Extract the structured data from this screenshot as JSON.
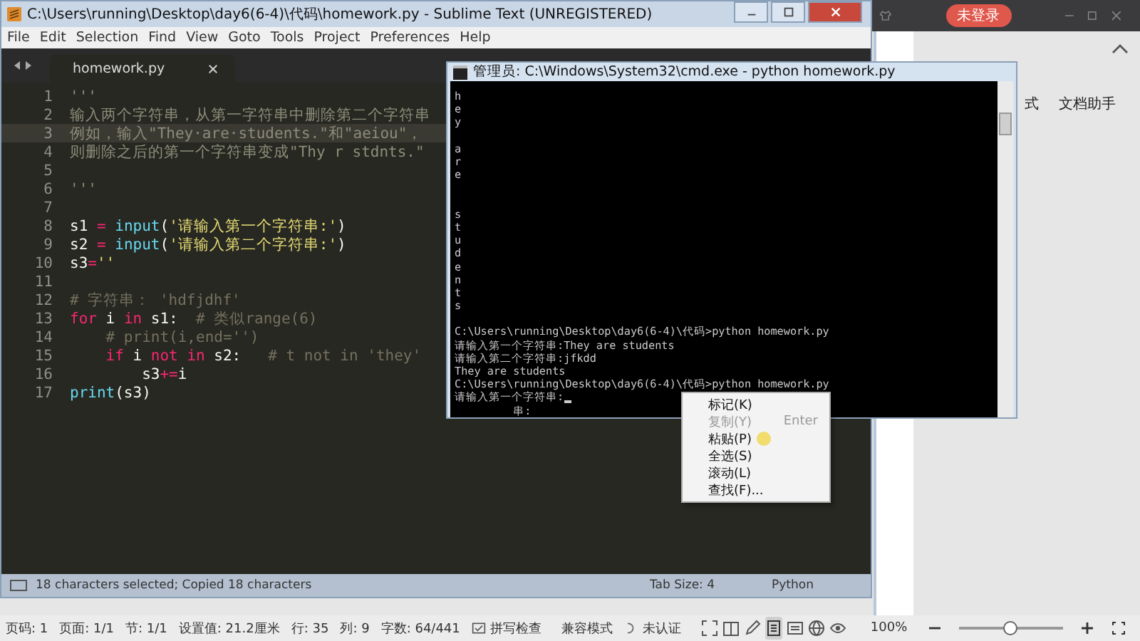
{
  "background_app": {
    "account_badge": "未登录",
    "ribbon": {
      "style_label": "式",
      "assistant_label": "文档助手"
    },
    "status_bar": {
      "items": [
        {
          "kind": "text",
          "text": "页码: 1"
        },
        {
          "kind": "text",
          "text": "页面: 1/1"
        },
        {
          "kind": "text",
          "text": "节: 1/1"
        },
        {
          "kind": "text",
          "text": "设置值: 21.2厘米"
        },
        {
          "kind": "text",
          "text": "行: 35"
        },
        {
          "kind": "text",
          "text": "列: 9"
        },
        {
          "kind": "text",
          "text": "字数: 64/441"
        },
        {
          "kind": "spell",
          "text": "拼写检查"
        },
        {
          "kind": "text",
          "text": "兼容模式"
        },
        {
          "kind": "cert",
          "text": "未认证"
        }
      ],
      "zoom": {
        "value": "100%",
        "level": 0.5
      }
    }
  },
  "editor": {
    "title": "C:\\Users\\running\\Desktop\\day6(6-4)\\代码\\homework.py - Sublime Text (UNREGISTERED)",
    "menu": [
      "File",
      "Edit",
      "Selection",
      "Find",
      "View",
      "Goto",
      "Tools",
      "Project",
      "Preferences",
      "Help"
    ],
    "tab": {
      "label": "homework.py",
      "selected": true
    },
    "lines": [
      {
        "number": "1",
        "current": false,
        "tokens": [
          {
            "kind": "docstring",
            "text": "'''"
          }
        ]
      },
      {
        "number": "2",
        "current": false,
        "tokens": [
          {
            "kind": "docstring",
            "text": "输入两个字符串，从第一字符串中删除第二个字符串"
          }
        ]
      },
      {
        "number": "3",
        "current": true,
        "tokens": [
          {
            "kind": "docstring",
            "text": "例如，输入\"They·are·students.\"和\"aeiou\"，"
          }
        ]
      },
      {
        "number": "4",
        "current": false,
        "tokens": [
          {
            "kind": "docstring",
            "text": "则删除之后的第一个字符串变成\"Thy r stdnts.\""
          }
        ]
      },
      {
        "number": "5",
        "current": false
      },
      {
        "number": "6",
        "current": false,
        "tokens": [
          {
            "kind": "docstring",
            "text": "'''"
          }
        ]
      },
      {
        "number": "7",
        "current": false
      },
      {
        "number": "8",
        "current": false,
        "tokens": [
          {
            "kind": "plain",
            "text": "s1 "
          },
          {
            "kind": "keyword",
            "text": "="
          },
          {
            "kind": "builtin",
            "text": " input"
          },
          {
            "kind": "plain",
            "text": "("
          },
          {
            "kind": "string",
            "text": "'请输入第一个字符串:'"
          },
          {
            "kind": "plain",
            "text": ")"
          }
        ]
      },
      {
        "number": "9",
        "current": false,
        "tokens": [
          {
            "kind": "plain",
            "text": "s2 "
          },
          {
            "kind": "keyword",
            "text": "="
          },
          {
            "kind": "builtin",
            "text": " input"
          },
          {
            "kind": "plain",
            "text": "("
          },
          {
            "kind": "string",
            "text": "'请输入第二个字符串:'"
          },
          {
            "kind": "plain",
            "text": ")"
          }
        ]
      },
      {
        "number": "10",
        "current": false,
        "tokens": [
          {
            "kind": "plain",
            "text": "s3"
          },
          {
            "kind": "keyword",
            "text": "="
          },
          {
            "kind": "string",
            "text": "''"
          }
        ]
      },
      {
        "number": "11",
        "current": false
      },
      {
        "number": "12",
        "current": false,
        "tokens": [
          {
            "kind": "comment",
            "text": "# 字符串： 'hdfjdhf'"
          }
        ]
      },
      {
        "number": "13",
        "current": false,
        "tokens": [
          {
            "kind": "keyword",
            "text": "for"
          },
          {
            "kind": "plain",
            "text": " i "
          },
          {
            "kind": "keyword",
            "text": "in"
          },
          {
            "kind": "plain",
            "text": " s1:  "
          },
          {
            "kind": "comment",
            "text": "# 类似range(6)"
          }
        ]
      },
      {
        "number": "14",
        "current": false,
        "tokens": [
          {
            "kind": "comment",
            "text": "    # print(i,end='')"
          }
        ]
      },
      {
        "number": "15",
        "current": false,
        "tokens": [
          {
            "kind": "keyword",
            "text": "    if"
          },
          {
            "kind": "plain",
            "text": " i "
          },
          {
            "kind": "keyword",
            "text": "not in"
          },
          {
            "kind": "plain",
            "text": " s2:   "
          },
          {
            "kind": "comment",
            "text": "# t not in 'they'"
          }
        ]
      },
      {
        "number": "16",
        "current": false,
        "tokens": [
          {
            "kind": "plain",
            "text": "        s3"
          },
          {
            "kind": "keyword",
            "text": "+="
          },
          {
            "kind": "plain",
            "text": "i"
          }
        ]
      },
      {
        "number": "17",
        "current": false,
        "tokens": [
          {
            "kind": "builtin",
            "text": "print"
          },
          {
            "kind": "plain",
            "text": "(s3)"
          }
        ]
      }
    ],
    "status_bar": {
      "message": "18 characters selected; Copied 18 characters",
      "tab_size": "Tab Size: 4",
      "syntax": "Python"
    }
  },
  "console": {
    "title": "管理员: C:\\Windows\\System32\\cmd.exe - python  homework.py",
    "lines": [
      {
        "kind": "text",
        "text": "h"
      },
      {
        "kind": "text",
        "text": "e"
      },
      {
        "kind": "text",
        "text": "y"
      },
      {
        "kind": "blank"
      },
      {
        "kind": "text",
        "text": "a"
      },
      {
        "kind": "text",
        "text": "r"
      },
      {
        "kind": "text",
        "text": "e"
      },
      {
        "kind": "blank"
      },
      {
        "kind": "blank"
      },
      {
        "kind": "text",
        "text": "s"
      },
      {
        "kind": "text",
        "text": "t"
      },
      {
        "kind": "text",
        "text": "u"
      },
      {
        "kind": "text",
        "text": "d"
      },
      {
        "kind": "text",
        "text": "e"
      },
      {
        "kind": "text",
        "text": "n"
      },
      {
        "kind": "text",
        "text": "t"
      },
      {
        "kind": "text",
        "text": "s"
      },
      {
        "kind": "blank"
      },
      {
        "kind": "text",
        "text": "C:\\Users\\running\\Desktop\\day6(6-4)\\代码>python homework.py"
      },
      {
        "kind": "text",
        "text": "请输入第一个字符串:They are students"
      },
      {
        "kind": "text",
        "text": "请输入第二个字符串:jfkdd"
      },
      {
        "kind": "text",
        "text": "They are students"
      },
      {
        "kind": "text",
        "text": "C:\\Users\\running\\Desktop\\day6(6-4)\\代码>python homework.py"
      },
      {
        "kind": "prompt",
        "text": "请输入第一个字符串:"
      },
      {
        "kind": "text",
        "text": "         串:"
      }
    ]
  },
  "context_menu": {
    "items": [
      {
        "label": "标记(K)",
        "disabled": false,
        "hovered": false
      },
      {
        "label": "复制(Y)",
        "disabled": true,
        "hovered": false,
        "shortcut": "Enter"
      },
      {
        "label": "粘贴(P)",
        "disabled": false,
        "hovered": true
      },
      {
        "label": "全选(S)",
        "disabled": false,
        "hovered": false
      },
      {
        "label": "滚动(L)",
        "disabled": false,
        "hovered": false
      },
      {
        "label": "查找(F)...",
        "disabled": false,
        "hovered": false
      }
    ]
  }
}
